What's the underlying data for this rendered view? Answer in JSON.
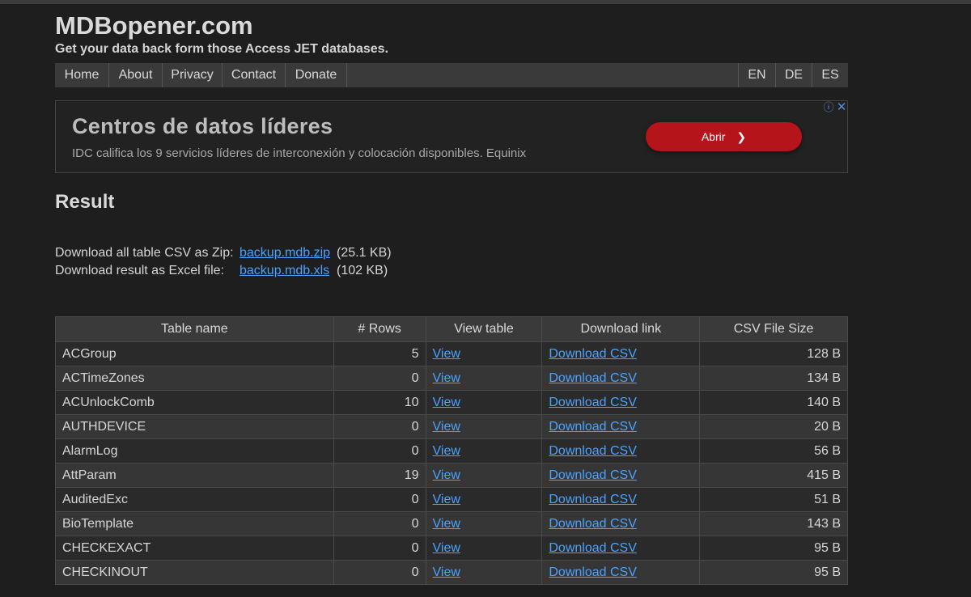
{
  "site": {
    "title": "MDBopener.com",
    "tagline": "Get your data back form those Access JET databases."
  },
  "nav": {
    "items": [
      "Home",
      "About",
      "Privacy",
      "Contact",
      "Donate"
    ],
    "languages": [
      "EN",
      "DE",
      "ES"
    ]
  },
  "ad": {
    "title": "Centros de datos líderes",
    "description": "IDC califica los 9 servicios líderes de interconexión y colocación disponibles. Equinix",
    "button_label": "Abrir",
    "button_icon": "chevron-right-icon",
    "info_icon": "ⓘ",
    "close_icon": "✕",
    "button_color": "#b5141b"
  },
  "result": {
    "heading": "Result",
    "zip": {
      "label": "Download all table CSV as Zip:",
      "link": "backup.mdb.zip",
      "size": "(25.1 KB)"
    },
    "excel": {
      "label": "Download result as Excel file:",
      "link": "backup.mdb.xls",
      "size": "(102 KB)"
    }
  },
  "table": {
    "headers": [
      "Table name",
      "# Rows",
      "View table",
      "Download link",
      "CSV File Size"
    ],
    "rows": [
      {
        "name": "ACGroup",
        "rows": "5",
        "view": "View",
        "download": "Download CSV",
        "size": "128 B"
      },
      {
        "name": "ACTimeZones",
        "rows": "0",
        "view": "View",
        "download": "Download CSV",
        "size": "134 B"
      },
      {
        "name": "ACUnlockComb",
        "rows": "10",
        "view": "View",
        "download": "Download CSV",
        "size": "140 B"
      },
      {
        "name": "AUTHDEVICE",
        "rows": "0",
        "view": "View",
        "download": "Download CSV",
        "size": "20 B"
      },
      {
        "name": "AlarmLog",
        "rows": "0",
        "view": "View",
        "download": "Download CSV",
        "size": "56 B"
      },
      {
        "name": "AttParam",
        "rows": "19",
        "view": "View",
        "download": "Download CSV",
        "size": "415 B"
      },
      {
        "name": "AuditedExc",
        "rows": "0",
        "view": "View",
        "download": "Download CSV",
        "size": "51 B"
      },
      {
        "name": "BioTemplate",
        "rows": "0",
        "view": "View",
        "download": "Download CSV",
        "size": "143 B"
      },
      {
        "name": "CHECKEXACT",
        "rows": "0",
        "view": "View",
        "download": "Download CSV",
        "size": "95 B"
      },
      {
        "name": "CHECKINOUT",
        "rows": "0",
        "view": "View",
        "download": "Download CSV",
        "size": "95 B"
      }
    ]
  }
}
